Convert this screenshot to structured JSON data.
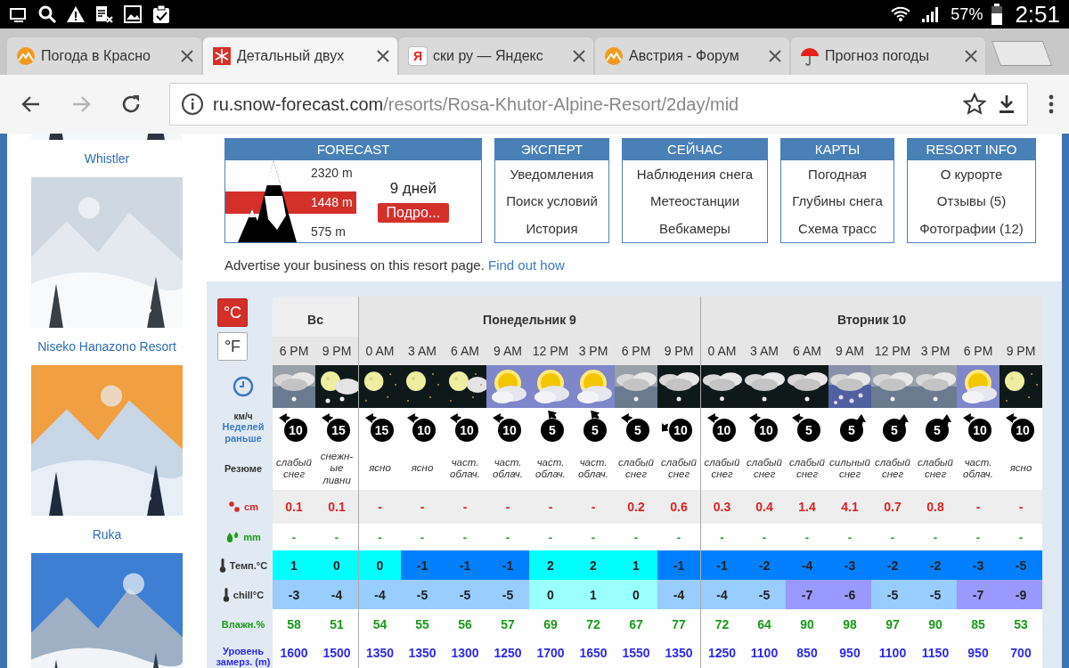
{
  "status_bar": {
    "battery": "57%",
    "time": "2:51"
  },
  "tabs": [
    {
      "title": "Погода в Красно",
      "kind": "mountain",
      "selected": false
    },
    {
      "title": "Детальный двух",
      "kind": "flake",
      "selected": true
    },
    {
      "title": "ски ру — Яндекс",
      "kind": "letter",
      "favicon_text": "Я",
      "selected": false
    },
    {
      "title": "Австрия - Форум",
      "kind": "mountain",
      "selected": false
    },
    {
      "title": "Прогноз погоды",
      "kind": "umbrella",
      "selected": false
    }
  ],
  "nav_buttons": [
    {
      "kind": "back",
      "disabled": false
    },
    {
      "kind": "forward",
      "disabled": true
    },
    {
      "kind": "reload",
      "disabled": false
    }
  ],
  "address_bar": {
    "domain": "ru.snow-forecast.com",
    "path": "/resorts/Rosa-Khutor-Alpine-Resort/2day/mid"
  },
  "sidebar": [
    {
      "kind": "picture"
    },
    {
      "kind": "caption",
      "text": "Whistler"
    },
    {
      "kind": "picture"
    },
    {
      "kind": "caption",
      "text": "Niseko Hanazono Resort"
    },
    {
      "kind": "picture"
    },
    {
      "kind": "caption",
      "text": "Ruka"
    },
    {
      "kind": "picture"
    }
  ],
  "forecast_box": {
    "title": "FORECAST",
    "elevations": [
      {
        "text": "2320 m",
        "selected": false
      },
      {
        "text": "1448 m",
        "selected": true
      },
      {
        "text": "575 m",
        "selected": false
      }
    ],
    "days": "9 дней",
    "button": "Подро..."
  },
  "menus": [
    {
      "title": "ЭКСПЕРТ",
      "links": [
        "Уведомления",
        "Поиск условий",
        "История"
      ]
    },
    {
      "title": "СЕЙЧАС",
      "links": [
        "Наблюдения снега",
        "Метеостанции",
        "Вебкамеры"
      ]
    },
    {
      "title": "КАРТЫ",
      "links": [
        "Погодная",
        "Глубины снега",
        "Схема трасс"
      ]
    },
    {
      "title": "RESORT INFO",
      "links": [
        "О курорте",
        "Отзывы (5)",
        "Фотографии (12)"
      ]
    }
  ],
  "advert": {
    "text": "Advertise your business on this resort page.",
    "link": "Find out how"
  },
  "units": [
    {
      "label": "°C",
      "selected": true
    },
    {
      "label": "°F",
      "selected": false
    }
  ],
  "row_labels": {
    "wind_unit": "км/ч",
    "week_earlier": "Неделей раньше",
    "summary": "Резюме",
    "snow": "cm",
    "rain": "mm",
    "temp": "Темп.°C",
    "chill": "chill°C",
    "humidity": "Влажн.%",
    "freezing": "Уровень замерз. (m)"
  },
  "days": [
    {
      "label": "Вс",
      "slots": [
        {
          "time": "6 PM",
          "kind": "cloud-snow",
          "wind": {
            "speed": "10",
            "kind": "nw"
          },
          "summary": "слабый снег",
          "snow": "0.1",
          "rain": "-",
          "temp": {
            "text": "1",
            "color": "#00ffff"
          },
          "chill": {
            "text": "-3",
            "color": "#99ccff"
          },
          "humidity": "58",
          "freezing": "1600"
        },
        {
          "time": "9 PM",
          "kind": "moon-cloud-snow",
          "wind": {
            "speed": "15",
            "kind": "nw"
          },
          "summary": "снежн-ые ливни",
          "snow": "0.1",
          "rain": "-",
          "temp": {
            "text": "0",
            "color": "#00ffff"
          },
          "chill": {
            "text": "-4",
            "color": "#99ccff"
          },
          "humidity": "51",
          "freezing": "1500"
        }
      ]
    },
    {
      "label": "Понедельник 9",
      "slots": [
        {
          "time": "0 AM",
          "kind": "moon",
          "wind": {
            "speed": "15",
            "kind": "nw"
          },
          "summary": "ясно",
          "snow": "-",
          "rain": "-",
          "temp": {
            "text": "0",
            "color": "#00ffff"
          },
          "chill": {
            "text": "-4",
            "color": "#99ccff"
          },
          "humidity": "54",
          "freezing": "1350"
        },
        {
          "time": "3 AM",
          "kind": "moon",
          "wind": {
            "speed": "10",
            "kind": "nw"
          },
          "summary": "ясно",
          "snow": "-",
          "rain": "-",
          "temp": {
            "text": "-1",
            "color": "#0080ff"
          },
          "chill": {
            "text": "-5",
            "color": "#99ccff"
          },
          "humidity": "55",
          "freezing": "1350"
        },
        {
          "time": "6 AM",
          "kind": "moon-cloud",
          "wind": {
            "speed": "10",
            "kind": "nw"
          },
          "summary": "част. облач.",
          "snow": "-",
          "rain": "-",
          "temp": {
            "text": "-1",
            "color": "#0080ff"
          },
          "chill": {
            "text": "-5",
            "color": "#99ccff"
          },
          "humidity": "56",
          "freezing": "1300"
        },
        {
          "time": "9 AM",
          "kind": "sun-cloud",
          "wind": {
            "speed": "10",
            "kind": "nw"
          },
          "summary": "част. облач.",
          "snow": "-",
          "rain": "-",
          "temp": {
            "text": "-1",
            "color": "#0080ff"
          },
          "chill": {
            "text": "-5",
            "color": "#99ccff"
          },
          "humidity": "57",
          "freezing": "1250"
        },
        {
          "time": "12 PM",
          "kind": "sun-cloud",
          "wind": {
            "speed": "5",
            "kind": "n"
          },
          "summary": "част. облач.",
          "snow": "-",
          "rain": "-",
          "temp": {
            "text": "2",
            "color": "#00ffff"
          },
          "chill": {
            "text": "0",
            "color": "#99ffff"
          },
          "humidity": "69",
          "freezing": "1700"
        },
        {
          "time": "3 PM",
          "kind": "sun-cloud",
          "wind": {
            "speed": "5",
            "kind": "n"
          },
          "summary": "част. облач.",
          "snow": "-",
          "rain": "-",
          "temp": {
            "text": "2",
            "color": "#00ffff"
          },
          "chill": {
            "text": "1",
            "color": "#99ffff"
          },
          "humidity": "72",
          "freezing": "1650"
        },
        {
          "time": "6 PM",
          "kind": "cloud-snow",
          "wind": {
            "speed": "5",
            "kind": "nw"
          },
          "summary": "слабый снег",
          "snow": "0.2",
          "rain": "-",
          "temp": {
            "text": "1",
            "color": "#00ffff"
          },
          "chill": {
            "text": "0",
            "color": "#99ffff"
          },
          "humidity": "67",
          "freezing": "1550"
        },
        {
          "time": "9 PM",
          "kind": "cloud-snow-night",
          "wind": {
            "speed": "10",
            "kind": "w"
          },
          "summary": "слабый снег",
          "snow": "0.6",
          "rain": "-",
          "temp": {
            "text": "-1",
            "color": "#0080ff"
          },
          "chill": {
            "text": "-4",
            "color": "#99ccff"
          },
          "humidity": "77",
          "freezing": "1350"
        }
      ]
    },
    {
      "label": "Вторник 10",
      "slots": [
        {
          "time": "0 AM",
          "kind": "cloud-snow-night",
          "wind": {
            "speed": "10",
            "kind": "nw"
          },
          "summary": "слабый снег",
          "snow": "0.3",
          "rain": "-",
          "temp": {
            "text": "-1",
            "color": "#0080ff"
          },
          "chill": {
            "text": "-4",
            "color": "#99ccff"
          },
          "humidity": "72",
          "freezing": "1250"
        },
        {
          "time": "3 AM",
          "kind": "cloud-snow-night",
          "wind": {
            "speed": "10",
            "kind": "nw"
          },
          "summary": "слабый снег",
          "snow": "0.4",
          "rain": "-",
          "temp": {
            "text": "-2",
            "color": "#0080ff"
          },
          "chill": {
            "text": "-5",
            "color": "#99ccff"
          },
          "humidity": "64",
          "freezing": "1100"
        },
        {
          "time": "6 AM",
          "kind": "cloud-snow-night",
          "wind": {
            "speed": "5",
            "kind": "nw"
          },
          "summary": "слабый снег",
          "snow": "1.4",
          "rain": "-",
          "temp": {
            "text": "-4",
            "color": "#0080ff"
          },
          "chill": {
            "text": "-7",
            "color": "#9999ff"
          },
          "humidity": "90",
          "freezing": "850"
        },
        {
          "time": "9 AM",
          "kind": "cloud-heavy-snow",
          "wind": {
            "speed": "5",
            "kind": "ne"
          },
          "summary": "сильный снег",
          "snow": "4.1",
          "rain": "-",
          "temp": {
            "text": "-3",
            "color": "#0080ff"
          },
          "chill": {
            "text": "-6",
            "color": "#9999ff"
          },
          "humidity": "98",
          "freezing": "950"
        },
        {
          "time": "12 PM",
          "kind": "cloud-snow",
          "wind": {
            "speed": "5",
            "kind": "ne"
          },
          "summary": "слабый снег",
          "snow": "0.7",
          "rain": "-",
          "temp": {
            "text": "-2",
            "color": "#0080ff"
          },
          "chill": {
            "text": "-5",
            "color": "#99ccff"
          },
          "humidity": "97",
          "freezing": "1100"
        },
        {
          "time": "3 PM",
          "kind": "cloud-snow",
          "wind": {
            "speed": "5",
            "kind": "ne"
          },
          "summary": "слабый снег",
          "snow": "0.8",
          "rain": "-",
          "temp": {
            "text": "-2",
            "color": "#0080ff"
          },
          "chill": {
            "text": "-5",
            "color": "#99ccff"
          },
          "humidity": "90",
          "freezing": "1150"
        },
        {
          "time": "6 PM",
          "kind": "sun-cloud",
          "wind": {
            "speed": "10",
            "kind": "nw"
          },
          "summary": "част. облач.",
          "snow": "-",
          "rain": "-",
          "temp": {
            "text": "-3",
            "color": "#0080ff"
          },
          "chill": {
            "text": "-7",
            "color": "#9999ff"
          },
          "humidity": "85",
          "freezing": "950"
        },
        {
          "time": "9 PM",
          "kind": "moon",
          "wind": {
            "speed": "10",
            "kind": "nw"
          },
          "summary": "ясно",
          "snow": "-",
          "rain": "-",
          "temp": {
            "text": "-5",
            "color": "#0080ff"
          },
          "chill": {
            "text": "-9",
            "color": "#9999ff"
          },
          "humidity": "53",
          "freezing": "700"
        }
      ]
    }
  ]
}
